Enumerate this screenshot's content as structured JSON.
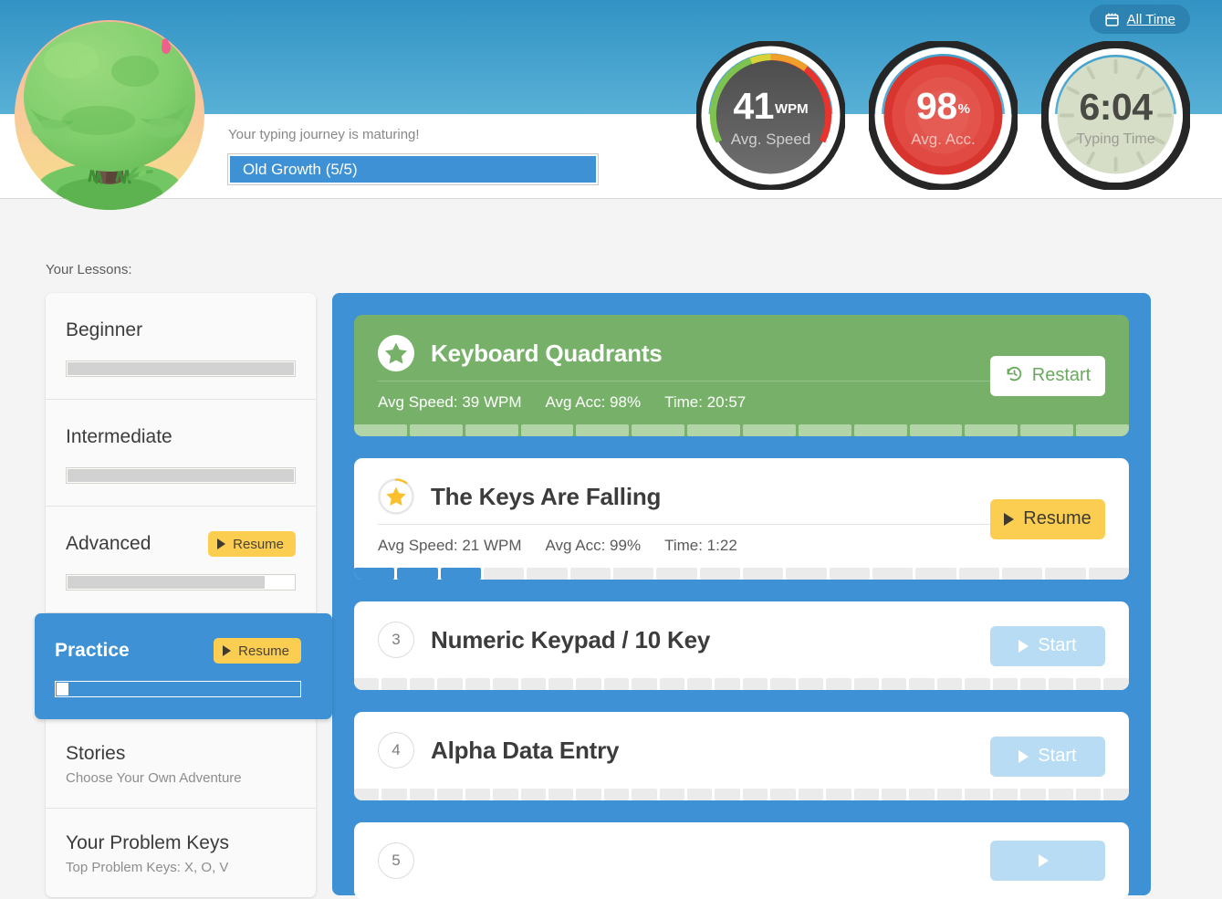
{
  "header": {
    "date_filter": {
      "label": "All Time",
      "icon": "calendar-icon"
    },
    "journey_message": "Your typing journey is maturing!",
    "journey_progress": {
      "label": "Old Growth (5/5)",
      "percent": 100,
      "color": "#3d91d4"
    },
    "tree_illustration": "tree-old-growth-illustration"
  },
  "stats": [
    {
      "key": "speed",
      "value": "41",
      "unit": "WPM",
      "label": "Avg. Speed",
      "style": "dark-gauge-with-color-arc"
    },
    {
      "key": "accuracy",
      "value": "98",
      "unit": "%",
      "label": "Avg. Acc.",
      "style": "red-target-circle",
      "color": "#e0403c"
    },
    {
      "key": "time",
      "value": "6:04",
      "unit": "",
      "label": "Typing Time",
      "style": "sage-clock-face",
      "color": "#d6dec8"
    }
  ],
  "sidebar": {
    "heading": "Your Lessons:",
    "items": [
      {
        "title": "Beginner",
        "subtitle": "",
        "percent": 100,
        "action": null,
        "active": false
      },
      {
        "title": "Intermediate",
        "subtitle": "",
        "percent": 100,
        "action": null,
        "active": false
      },
      {
        "title": "Advanced",
        "subtitle": "",
        "percent": 87,
        "action": "Resume",
        "active": false
      },
      {
        "title": "Practice",
        "subtitle": "",
        "percent": 5,
        "action": "Resume",
        "active": true
      },
      {
        "title": "Stories",
        "subtitle": "Choose Your Own Adventure",
        "percent": null,
        "action": null,
        "active": false
      },
      {
        "title": "Your Problem Keys",
        "subtitle": "Top Problem Keys: X, O, V",
        "percent": null,
        "action": null,
        "active": false
      }
    ]
  },
  "lessons": [
    {
      "index": "1",
      "badge": "star-filled-icon",
      "title": "Keyboard Quadrants",
      "state": "completed",
      "stats": [
        "Avg Speed: 39 WPM",
        "Avg Acc: 98%",
        "Time: 20:57"
      ],
      "action": {
        "label": "Restart",
        "icon": "history-clock-icon",
        "style": "restart"
      },
      "segments_total": 14,
      "segments_done": 14
    },
    {
      "index": "2",
      "badge": "star-progress-icon",
      "title": "The Keys Are Falling",
      "state": "in-progress",
      "stats": [
        "Avg Speed: 21 WPM",
        "Avg Acc: 99%",
        "Time: 1:22"
      ],
      "action": {
        "label": "Resume",
        "icon": "play-icon",
        "style": "resume"
      },
      "segments_total": 18,
      "segments_done": 3
    },
    {
      "index": "3",
      "badge": "number-icon",
      "title": "Numeric Keypad / 10 Key",
      "state": "not-started",
      "stats": [],
      "action": {
        "label": "Start",
        "icon": "play-icon",
        "style": "start"
      },
      "segments_total": 28,
      "segments_done": 0
    },
    {
      "index": "4",
      "badge": "number-icon",
      "title": "Alpha Data Entry",
      "state": "not-started",
      "stats": [],
      "action": {
        "label": "Start",
        "icon": "play-icon",
        "style": "start"
      },
      "segments_total": 28,
      "segments_done": 0
    },
    {
      "index": "5",
      "badge": "number-icon",
      "title": "",
      "state": "not-started",
      "stats": [],
      "action": {
        "label": "",
        "icon": "play-icon",
        "style": "start"
      },
      "segments_total": 28,
      "segments_done": 0
    }
  ],
  "colors": {
    "accent_blue": "#3d91d4",
    "header_blue_top": "#3293c4",
    "header_blue_bottom": "#58b0d6",
    "green_done": "#77b169",
    "yellow_resume": "#fbce52",
    "start_blue": "#b8dcf4",
    "page_bg": "#f4f4f4"
  }
}
